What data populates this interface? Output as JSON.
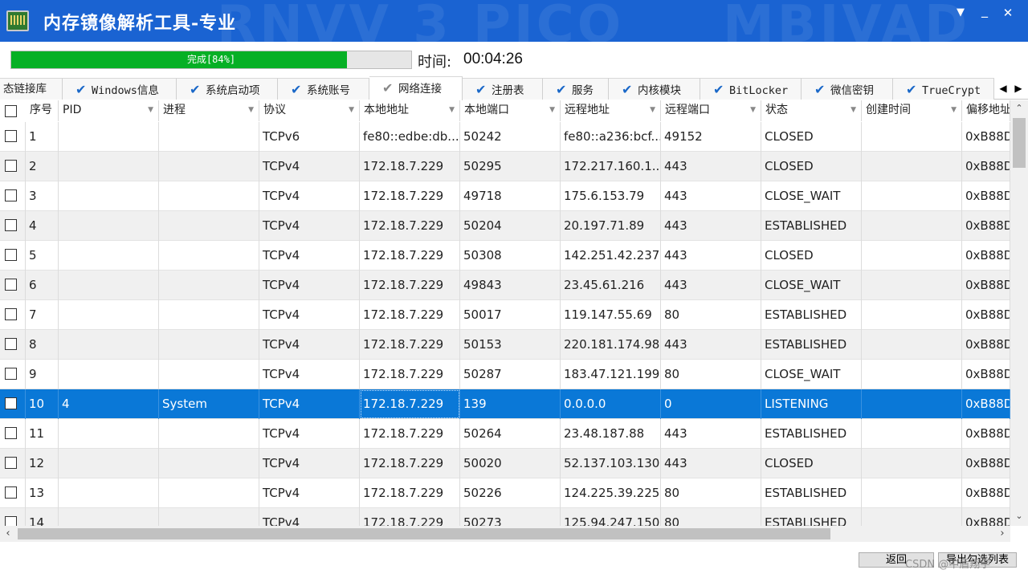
{
  "app": {
    "title": "内存镜像解析工具-专业",
    "window_controls": [
      "pin-icon",
      "minimize-icon",
      "close-icon"
    ]
  },
  "progress": {
    "text": "完成[84%]",
    "value_percent": 84,
    "time_label": "时间:",
    "time_value": "00:04:26"
  },
  "tabs": [
    {
      "label": "态链接库",
      "checked": false
    },
    {
      "label": "Windows信息",
      "checked": true
    },
    {
      "label": "系统启动项",
      "checked": true
    },
    {
      "label": "系统账号",
      "checked": true
    },
    {
      "label": "网络连接",
      "checked": true,
      "active": true
    },
    {
      "label": "注册表",
      "checked": true
    },
    {
      "label": "服务",
      "checked": true
    },
    {
      "label": "内核模块",
      "checked": true
    },
    {
      "label": "BitLocker",
      "checked": true
    },
    {
      "label": "微信密钥",
      "checked": true
    },
    {
      "label": "TrueCrypt",
      "checked": true
    }
  ],
  "columns": [
    "序号",
    "PID",
    "进程",
    "协议",
    "本地地址",
    "本地端口",
    "远程地址",
    "远程端口",
    "状态",
    "创建时间",
    "偏移地址"
  ],
  "rows": [
    [
      "1",
      "",
      "",
      "TCPv6",
      "fe80::edbe:db...",
      "50242",
      "fe80::a236:bcf...",
      "49152",
      "CLOSED",
      "",
      "0xB88D"
    ],
    [
      "2",
      "",
      "",
      "TCPv4",
      "172.18.7.229",
      "50295",
      "172.217.160.1...",
      "443",
      "CLOSED",
      "",
      "0xB88D"
    ],
    [
      "3",
      "",
      "",
      "TCPv4",
      "172.18.7.229",
      "49718",
      "175.6.153.79",
      "443",
      "CLOSE_WAIT",
      "",
      "0xB88D"
    ],
    [
      "4",
      "",
      "",
      "TCPv4",
      "172.18.7.229",
      "50204",
      "20.197.71.89",
      "443",
      "ESTABLISHED",
      "",
      "0xB88D"
    ],
    [
      "5",
      "",
      "",
      "TCPv4",
      "172.18.7.229",
      "50308",
      "142.251.42.237",
      "443",
      "CLOSED",
      "",
      "0xB88D"
    ],
    [
      "6",
      "",
      "",
      "TCPv4",
      "172.18.7.229",
      "49843",
      "23.45.61.216",
      "443",
      "CLOSE_WAIT",
      "",
      "0xB88D"
    ],
    [
      "7",
      "",
      "",
      "TCPv4",
      "172.18.7.229",
      "50017",
      "119.147.55.69",
      "80",
      "ESTABLISHED",
      "",
      "0xB88D"
    ],
    [
      "8",
      "",
      "",
      "TCPv4",
      "172.18.7.229",
      "50153",
      "220.181.174.98",
      "443",
      "ESTABLISHED",
      "",
      "0xB88D"
    ],
    [
      "9",
      "",
      "",
      "TCPv4",
      "172.18.7.229",
      "50287",
      "183.47.121.199",
      "80",
      "CLOSE_WAIT",
      "",
      "0xB88D"
    ],
    [
      "10",
      "4",
      "System",
      "TCPv4",
      "172.18.7.229",
      "139",
      "0.0.0.0",
      "0",
      "LISTENING",
      "",
      "0xB88D"
    ],
    [
      "11",
      "",
      "",
      "TCPv4",
      "172.18.7.229",
      "50264",
      "23.48.187.88",
      "443",
      "ESTABLISHED",
      "",
      "0xB88D"
    ],
    [
      "12",
      "",
      "",
      "TCPv4",
      "172.18.7.229",
      "50020",
      "52.137.103.130",
      "443",
      "CLOSED",
      "",
      "0xB88D"
    ],
    [
      "13",
      "",
      "",
      "TCPv4",
      "172.18.7.229",
      "50226",
      "124.225.39.225",
      "80",
      "ESTABLISHED",
      "",
      "0xB88D"
    ],
    [
      "14",
      "",
      "",
      "TCPv4",
      "172.18.7.229",
      "50273",
      "125.94.247.150",
      "80",
      "ESTABLISHED",
      "",
      "0xB88D"
    ]
  ],
  "selected_row": "10",
  "buttons": {
    "back": "返回",
    "export": "导出勾选列表"
  },
  "watermark": "CSDN @中盾翔宇",
  "colors": {
    "titlebar": "#1a63d2",
    "progress": "#06b025",
    "selection": "#0a78d7",
    "check": "#1a68c8"
  }
}
